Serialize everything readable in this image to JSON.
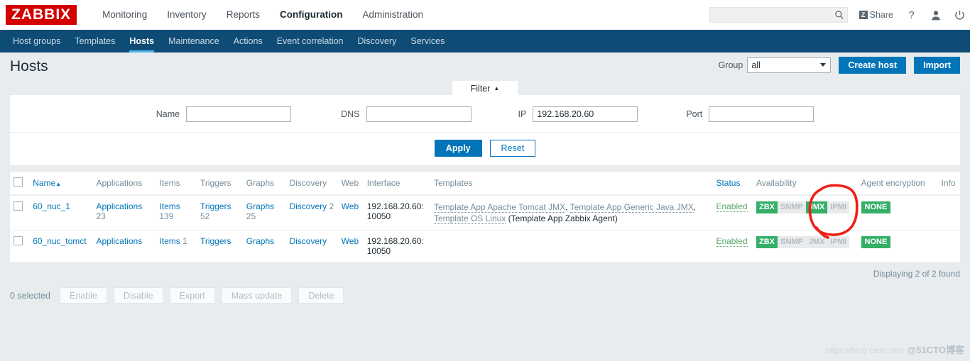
{
  "header": {
    "logo_text": "ZABBIX",
    "nav": [
      {
        "label": "Monitoring",
        "selected": false
      },
      {
        "label": "Inventory",
        "selected": false
      },
      {
        "label": "Reports",
        "selected": false
      },
      {
        "label": "Configuration",
        "selected": true
      },
      {
        "label": "Administration",
        "selected": false
      }
    ],
    "search_value": "",
    "search_placeholder": "",
    "search_icon": "search-icon",
    "share_badge": "Z",
    "share_label": "Share",
    "help_icon": "?",
    "user_icon": "user-icon",
    "power_icon": "power-icon"
  },
  "subnav": [
    {
      "label": "Host groups",
      "selected": false
    },
    {
      "label": "Templates",
      "selected": false
    },
    {
      "label": "Hosts",
      "selected": true
    },
    {
      "label": "Maintenance",
      "selected": false
    },
    {
      "label": "Actions",
      "selected": false
    },
    {
      "label": "Event correlation",
      "selected": false
    },
    {
      "label": "Discovery",
      "selected": false
    },
    {
      "label": "Services",
      "selected": false
    }
  ],
  "page": {
    "title": "Hosts",
    "group_label": "Group",
    "group_value": "all",
    "create_host_label": "Create host",
    "import_label": "Import"
  },
  "filter": {
    "tab_label": "Filter",
    "tab_arrow": "▲",
    "fields": [
      {
        "label": "Name",
        "value": "",
        "name": "filter-name-input"
      },
      {
        "label": "DNS",
        "value": "",
        "name": "filter-dns-input"
      },
      {
        "label": "IP",
        "value": "192.168.20.60",
        "name": "filter-ip-input"
      },
      {
        "label": "Port",
        "value": "",
        "name": "filter-port-input"
      }
    ],
    "apply_label": "Apply",
    "reset_label": "Reset"
  },
  "table": {
    "columns": [
      "Name",
      "Applications",
      "Items",
      "Triggers",
      "Graphs",
      "Discovery",
      "Web",
      "Interface",
      "Templates",
      "Status",
      "Availability",
      "Agent encryption",
      "Info"
    ],
    "sort_column": "Name",
    "sort_arrow": "▲",
    "rows": [
      {
        "name": "60_nuc_1",
        "applications_label": "Applications",
        "applications_count": "23",
        "items_label": "Items",
        "items_count": "139",
        "triggers_label": "Triggers",
        "triggers_count": "52",
        "graphs_label": "Graphs",
        "graphs_count": "25",
        "discovery_label": "Discovery",
        "discovery_count": "2",
        "web_label": "Web",
        "interface": "192.168.20.60: 10050",
        "templates": [
          {
            "text": "Template App Apache Tomcat JMX",
            "sep": ", "
          },
          {
            "text": "Template App Generic Java JMX",
            "sep": ", "
          },
          {
            "text": "Template OS Linux",
            "sep": " "
          },
          {
            "text": "(Template App Zabbix Agent)",
            "sep": ""
          }
        ],
        "status": "Enabled",
        "availability": [
          {
            "label": "ZBX",
            "active": true
          },
          {
            "label": "SNMP",
            "active": false
          },
          {
            "label": "JMX",
            "active": true
          },
          {
            "label": "IPMI",
            "active": false
          }
        ],
        "encryption": "NONE",
        "info": ""
      },
      {
        "name": "60_nuc_tomct",
        "applications_label": "Applications",
        "applications_count": "",
        "items_label": "Items",
        "items_count": "1",
        "triggers_label": "Triggers",
        "triggers_count": "",
        "graphs_label": "Graphs",
        "graphs_count": "",
        "discovery_label": "Discovery",
        "discovery_count": "",
        "web_label": "Web",
        "interface": "192.168.20.60: 10050",
        "templates": [],
        "status": "Enabled",
        "availability": [
          {
            "label": "ZBX",
            "active": true
          },
          {
            "label": "SNMP",
            "active": false
          },
          {
            "label": "JMX",
            "active": false
          },
          {
            "label": "IPMI",
            "active": false
          }
        ],
        "encryption": "NONE",
        "info": ""
      }
    ],
    "displaying": "Displaying 2 of 2 found"
  },
  "footer": {
    "selected_label": "0 selected",
    "buttons": [
      "Enable",
      "Disable",
      "Export",
      "Mass update",
      "Delete"
    ]
  },
  "watermark": {
    "url": "https://blog.csdn.net/",
    "cto": "@51CTO博客"
  },
  "annotation": {
    "type": "hand-drawn-circle",
    "color": "#f01e14",
    "target": "JMX availability badge (row 1)"
  }
}
